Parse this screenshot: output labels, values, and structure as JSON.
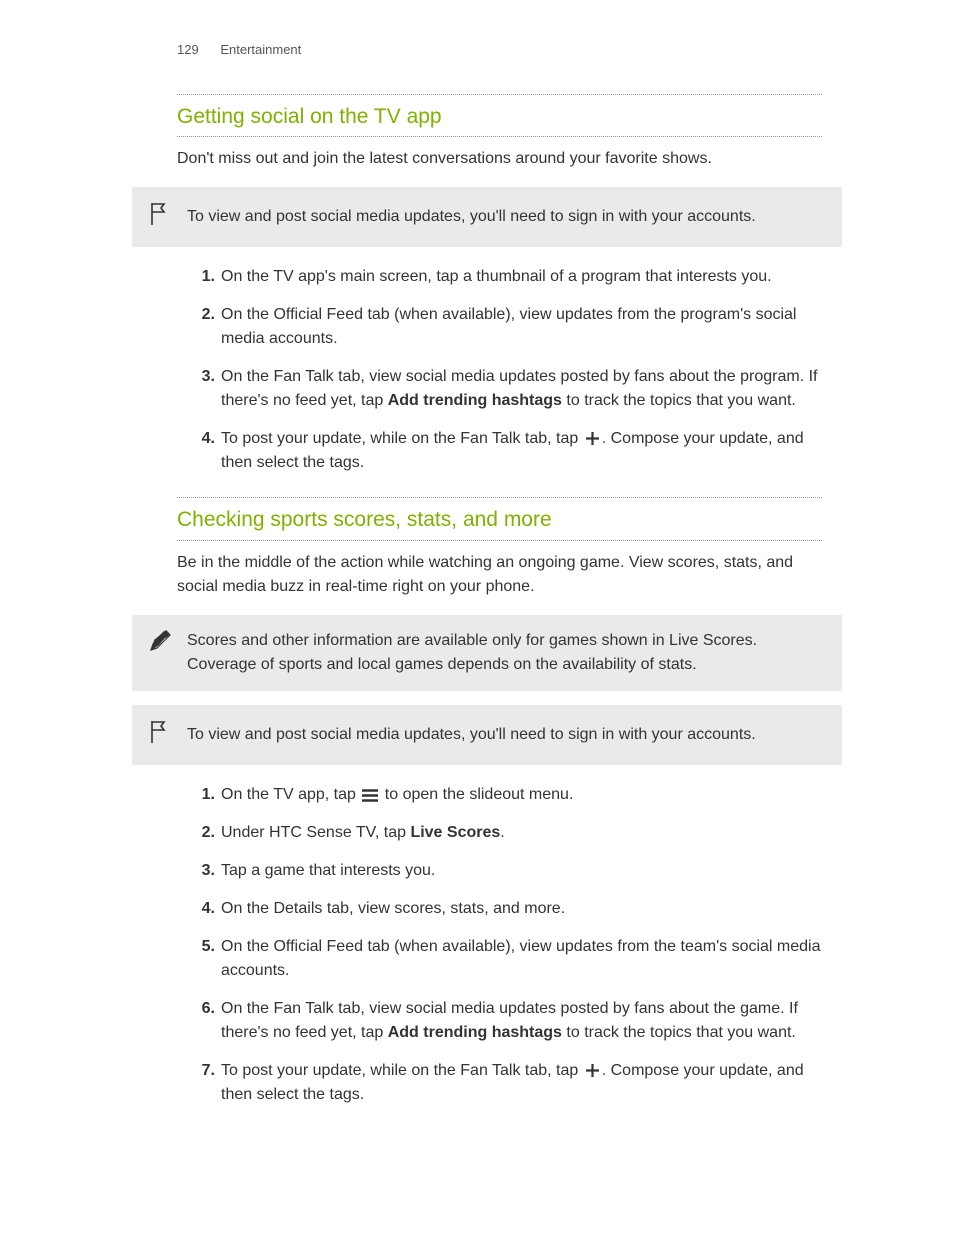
{
  "header": {
    "page_number": "129",
    "section": "Entertainment"
  },
  "section1": {
    "title": "Getting social on the TV app",
    "intro": "Don't miss out and join the latest conversations around your favorite shows.",
    "callout": "To view and post social media updates, you'll need to sign in with your accounts.",
    "step1": "On the TV app's main screen, tap a thumbnail of a program that interests you.",
    "step2": "On the Official Feed tab (when available), view updates from the program's social media accounts.",
    "step3_a": "On the Fan Talk tab, view social media updates posted by fans about the program. If there's no feed yet, tap ",
    "step3_bold": "Add trending hashtags",
    "step3_b": " to track the topics that you want.",
    "step4_a": "To post your update, while on the Fan Talk tab, tap ",
    "step4_b": ". Compose your update, and then select the tags."
  },
  "section2": {
    "title": "Checking sports scores, stats, and more",
    "intro": "Be in the middle of the action while watching an ongoing game. View scores, stats, and social media buzz in real-time right on your phone.",
    "callout_info": "Scores and other information are available only for games shown in Live Scores. Coverage of sports and local games depends on the availability of stats.",
    "callout_flag": "To view and post social media updates, you'll need to sign in with your accounts.",
    "step1_a": "On the TV app, tap ",
    "step1_b": " to open the slideout menu.",
    "step2_a": "Under HTC Sense TV, tap ",
    "step2_bold": "Live Scores",
    "step2_b": ".",
    "step3": "Tap a game that interests you.",
    "step4": "On the Details tab, view scores, stats, and more.",
    "step5": "On the Official Feed tab (when available), view updates from the team's social media accounts.",
    "step6_a": "On the Fan Talk tab, view social media updates posted by fans about the game. If there's no feed yet, tap ",
    "step6_bold": "Add trending hashtags",
    "step6_b": " to track the topics that you want.",
    "step7_a": "To post your update, while on the Fan Talk tab, tap ",
    "step7_b": ". Compose your update, and then select the tags."
  }
}
